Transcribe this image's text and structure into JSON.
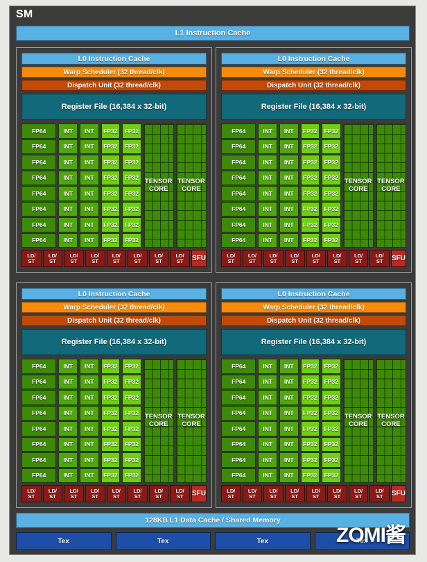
{
  "diagram": {
    "title": "SM",
    "top_cache": "L1 Instruction Cache",
    "bottom_cache": "128KB L1 Data Cache / Shared Memory",
    "watermark": "ZOMI酱"
  },
  "processing_block": {
    "l0_instruction_cache": "L0 Instruction Cache",
    "warp_scheduler": "Warp Scheduler (32 thread/clk)",
    "dispatch_unit": "Dispatch Unit (32 thread/clk)",
    "register_file": "Register File (16,384 x 32-bit)",
    "core_labels": {
      "fp64": "FP64",
      "int": "INT",
      "fp32": "FP32",
      "tensor_core_line1": "TENSOR",
      "tensor_core_line2": "CORE",
      "ldst_line1": "LD/",
      "ldst_line2": "ST",
      "sfu": "SFU"
    },
    "counts": {
      "fp64_rows": 8,
      "int_columns": 2,
      "fp32_columns": 2,
      "tensor_cores": 2,
      "ldst_units": 8,
      "sfu_units": 1
    }
  },
  "tex_units": [
    "Tex",
    "Tex",
    "Tex",
    "Tex"
  ],
  "colors": {
    "page_background": "#e8e8e6",
    "sm_background": "#3b3b3b",
    "instruction_cache": "#58b0e3",
    "warp_scheduler": "#f58a0b",
    "dispatch_unit": "#c24a06",
    "register_file": "#11697a",
    "fp64": "#3d8a08",
    "int": "#4fa70d",
    "fp32": "#6ed010",
    "tensor_core": "#3d8a08",
    "ldst": "#8b1a16",
    "sfu": "#bb2a22",
    "tex": "#1d4ea8"
  }
}
